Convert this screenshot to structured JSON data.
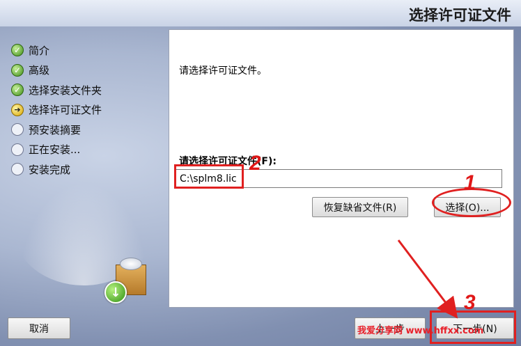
{
  "window": {
    "title": "选择许可证文件"
  },
  "steps": [
    {
      "label": "简介",
      "status": "done"
    },
    {
      "label": "高级",
      "status": "done"
    },
    {
      "label": "选择安装文件夹",
      "status": "done"
    },
    {
      "label": "选择许可证文件",
      "status": "current"
    },
    {
      "label": "预安装摘要",
      "status": "pending"
    },
    {
      "label": "正在安装...",
      "status": "pending"
    },
    {
      "label": "安装完成",
      "status": "pending"
    }
  ],
  "panel": {
    "instruction": "请选择许可证文件。",
    "field_label": "请选择许可证文件(F):",
    "license_value": "C:\\splm8.lic",
    "restore_label": "恢复缺省文件(R)",
    "select_label": "选择(O)..."
  },
  "footer": {
    "cancel_label": "取消",
    "back_label": "上一步",
    "next_label": "下一步(N)"
  },
  "annotations": {
    "n1": "1",
    "n2": "2",
    "n3": "3",
    "color": "#e02020"
  },
  "watermark": "我爱分享网 www.hffxx.com"
}
